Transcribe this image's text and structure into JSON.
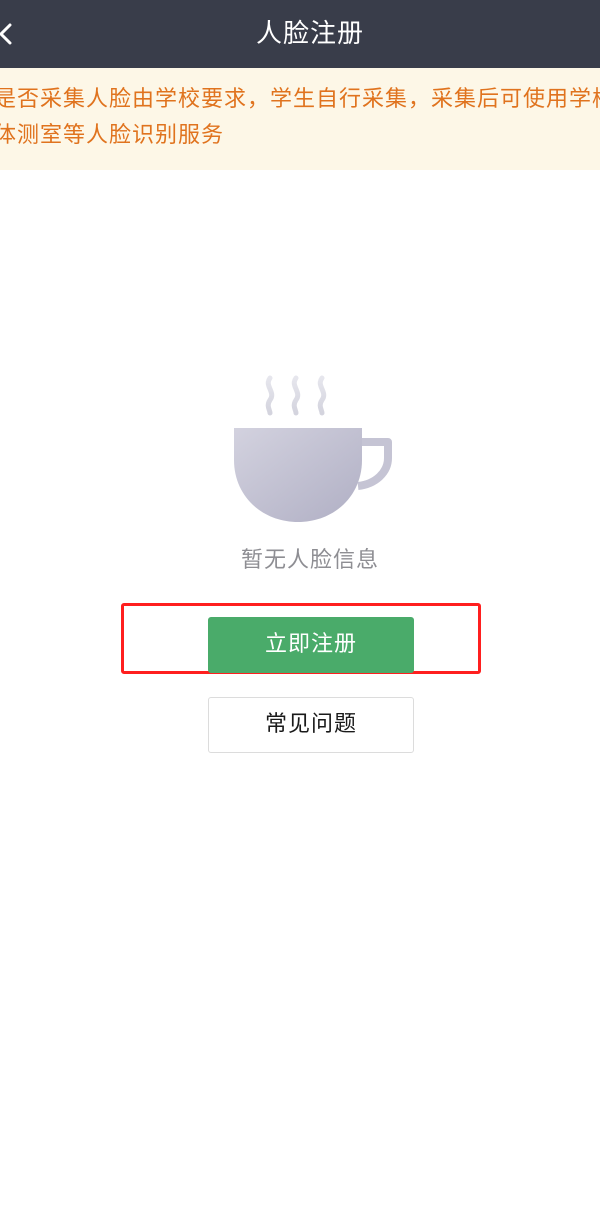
{
  "nav": {
    "title": "人脸注册",
    "back_icon": "chevron-left-icon"
  },
  "notice": {
    "text": "是否采集人脸由学校要求，学生自行采集，采集后可使用学校体测室等人脸识别服务"
  },
  "empty_state": {
    "icon": "coffee-cup-icon",
    "text": "暂无人脸信息"
  },
  "buttons": {
    "register_label": "立即注册",
    "faq_label": "常见问题"
  },
  "colors": {
    "nav_background": "#393d4a",
    "notice_background": "#fdf7e7",
    "notice_text": "#e0731e",
    "primary_button": "#4aab6a",
    "highlight_border": "#ff1f1f"
  }
}
